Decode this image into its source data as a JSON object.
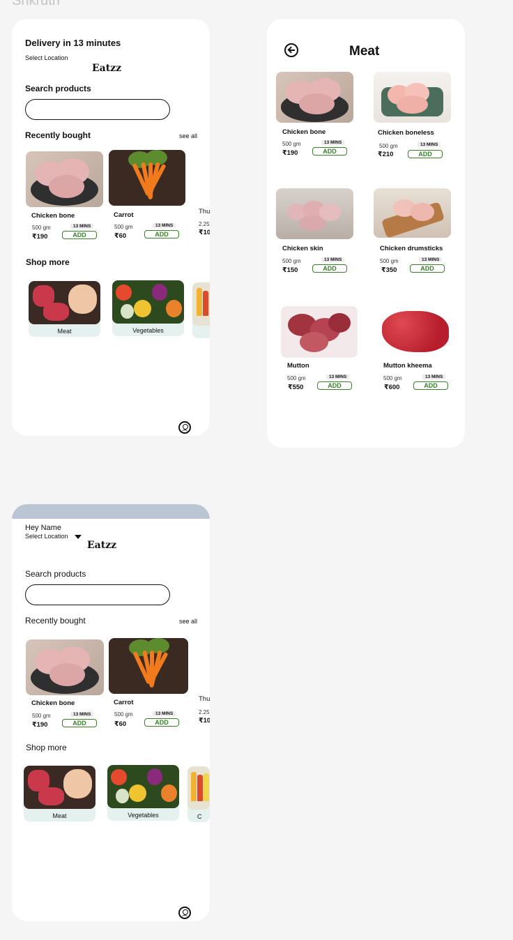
{
  "canvas": {
    "title": "Srikruth"
  },
  "home": {
    "delivery_title": "Delivery in 13 minutes",
    "select_location": "Select Location",
    "brand": "Eatzz",
    "search_label": "Search products",
    "recently_bought": "Recently bought",
    "see_all": "see all",
    "shop_more": "Shop more",
    "products": [
      {
        "name": "Chicken bone",
        "weight": "500 gm",
        "price": "₹190",
        "mins": "13 MINS",
        "add": "ADD"
      },
      {
        "name": "Carrot",
        "weight": "500 gm",
        "price": "₹60",
        "mins": "13 MINS",
        "add": "ADD"
      },
      {
        "name": "Thu",
        "weight": "2.25",
        "price": "₹10"
      }
    ],
    "categories": [
      {
        "label": "Meat"
      },
      {
        "label": "Vegetables"
      }
    ]
  },
  "meat": {
    "title": "Meat",
    "products": [
      {
        "name": "Chicken bone",
        "weight": "500 gm",
        "price": "₹190",
        "mins": "13 MINS",
        "add": "ADD"
      },
      {
        "name": "Chicken boneless",
        "weight": "500 gm",
        "price": "₹210",
        "mins": "13 MINS",
        "add": "ADD"
      },
      {
        "name": "Chicken skin",
        "weight": "500 gm",
        "price": "₹150",
        "mins": "13 MINS",
        "add": "ADD"
      },
      {
        "name": "Chicken drumsticks",
        "weight": "500 gm",
        "price": "₹350",
        "mins": "13 MINS",
        "add": "ADD"
      },
      {
        "name": "Mutton",
        "weight": "500 gm",
        "price": "₹550",
        "mins": "13 MINS",
        "add": "ADD"
      },
      {
        "name": "Mutton kheema",
        "weight": "500 gm",
        "price": "₹600",
        "mins": "13 MINS",
        "add": "ADD"
      }
    ]
  },
  "home2": {
    "greeting": "Hey Name",
    "select_location": "Select Location",
    "brand": "Eatzz",
    "search_label": "Search products",
    "recently_bought": "Recently bought",
    "see_all": "see all",
    "shop_more": "Shop more",
    "products": [
      {
        "name": "Chicken bone",
        "weight": "500 gm",
        "price": "₹190",
        "mins": "13 MINS",
        "add": "ADD"
      },
      {
        "name": "Carrot",
        "weight": "500 gm",
        "price": "₹60",
        "mins": "13 MINS",
        "add": "ADD"
      },
      {
        "name": "Thu",
        "weight": "2.25",
        "price": "₹10"
      }
    ],
    "categories": [
      {
        "label": "Meat"
      },
      {
        "label": "Vegetables"
      },
      {
        "label": "C"
      }
    ]
  },
  "icons": {
    "profile": "user-circle-icon",
    "back": "arrow-left-circle-icon",
    "dropdown": "caret-down-icon"
  },
  "colors": {
    "canvas_bg": "#f5f5f5",
    "frame_bg": "#ffffff",
    "add_green": "#3a7d2a",
    "category_bg": "#e5f1ef",
    "status_bar": "#bcc5d3"
  }
}
